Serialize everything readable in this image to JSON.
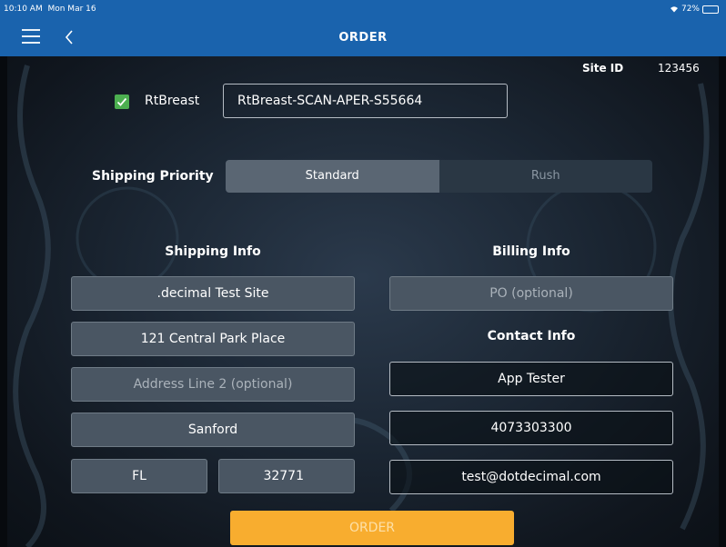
{
  "status": {
    "time": "10:10 AM",
    "date": "Mon Mar 16",
    "wifi_icon": "wifi-icon",
    "battery": "72%",
    "battery_level": 0.72
  },
  "nav": {
    "title": "ORDER",
    "menu_icon": "hamburger-menu-icon",
    "back_icon": "chevron-left-icon"
  },
  "site": {
    "label": "Site ID",
    "value": "123456"
  },
  "scan": {
    "checked": true,
    "label": "RtBreast",
    "value": "RtBreast-SCAN-APER-S55664"
  },
  "priority": {
    "label": "Shipping Priority",
    "options": [
      "Standard",
      "Rush"
    ],
    "selected": "Standard"
  },
  "shipping": {
    "title": "Shipping Info",
    "site_name": ".decimal Test Site",
    "address1": "121 Central Park Place",
    "address2_placeholder": "Address Line 2 (optional)",
    "city": "Sanford",
    "state": "FL",
    "zip": "32771"
  },
  "billing": {
    "title": "Billing Info",
    "po_placeholder": "PO (optional)"
  },
  "contact": {
    "title": "Contact Info",
    "name": "App Tester",
    "phone": "4073303300",
    "email": "test@dotdecimal.com"
  },
  "order_button": "ORDER",
  "colors": {
    "nav": "#1a63ad",
    "accent": "#f8ad2f",
    "check": "#4caf50"
  }
}
